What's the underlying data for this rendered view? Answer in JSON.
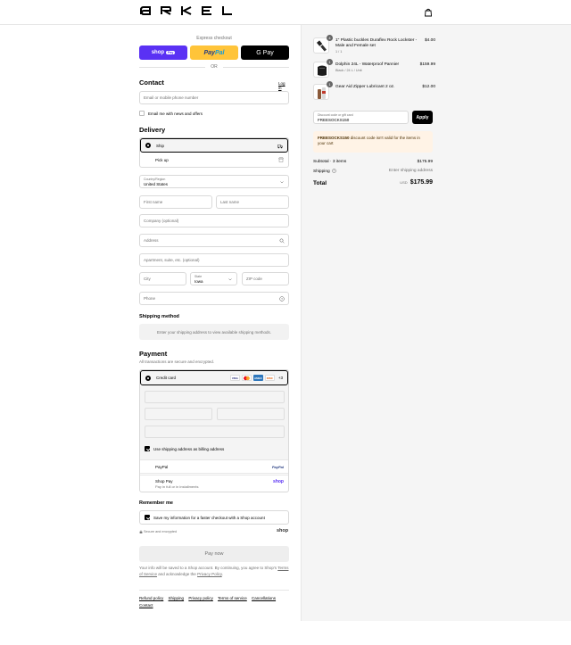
{
  "header": {
    "brand": "ARKEL",
    "cart_icon": "shopping-bag-icon"
  },
  "express": {
    "title": "Express checkout",
    "shop_pay": "shop",
    "shop_pay_pill": "Pay",
    "paypal_a": "Pay",
    "paypal_b": "Pal",
    "gpay": "G Pay",
    "or": "OR"
  },
  "contact": {
    "heading": "Contact",
    "login": "Log in",
    "email_placeholder": "Email or mobile phone number",
    "news_label": "Email me with news and offers",
    "news_checked": false
  },
  "delivery": {
    "heading": "Delivery",
    "options": [
      {
        "label": "Ship",
        "selected": true,
        "icon": "truck-icon"
      },
      {
        "label": "Pick up",
        "selected": false,
        "icon": "store-icon"
      }
    ],
    "country_label": "Country/Region",
    "country_value": "United States",
    "first_name": "First name",
    "last_name": "Last name",
    "company": "Company (optional)",
    "address": "Address",
    "apartment": "Apartment, suite, etc. (optional)",
    "city": "City",
    "state_label": "State",
    "state_value": "Iowa",
    "zip": "ZIP code",
    "phone": "Phone"
  },
  "shipping_method": {
    "heading": "Shipping method",
    "note": "Enter your shipping address to view available shipping methods."
  },
  "payment": {
    "heading": "Payment",
    "subtitle": "All transactions are secure and encrypted.",
    "options": [
      {
        "label": "Credit card",
        "selected": true
      },
      {
        "label": "PayPal",
        "selected": false,
        "logo": "PayPal"
      },
      {
        "label": "Shop Pay",
        "sub": "Pay in full or in installments",
        "selected": false,
        "logo": "shop"
      }
    ],
    "card_brands": [
      "VISA",
      "MC",
      "AMEX",
      "DISC"
    ],
    "more_cards": "+3",
    "billing_label": "Use shipping address as billing address",
    "billing_checked": true
  },
  "remember": {
    "heading": "Remember me",
    "label": "Save my information for a faster checkout with a Shop account",
    "checked": true,
    "secure": "Secure and encrypted",
    "shop_logo": "shop"
  },
  "pay_now": "Pay now",
  "fine_print": {
    "line1": "Your info will be saved to a Shop account. By continuing, you agree to Shop's",
    "tos": "Terms of Service",
    "mid": " and acknowledge the ",
    "privacy": "Privacy Policy",
    "end": "."
  },
  "footer": [
    "Refund policy",
    "Shipping",
    "Privacy policy",
    "Terms of service",
    "Cancellations",
    "Contact"
  ],
  "cart": {
    "items": [
      {
        "name": "1\" Plastic buckles Duraflex Rock Lockster - Male and Female set",
        "variant": "1 / 1",
        "qty": "4",
        "price": "$4.00"
      },
      {
        "name": "Dolphin 24L - Waterproof Pannier",
        "variant": "Black / 24 L / Unit",
        "qty": "1",
        "price": "$159.99"
      },
      {
        "name": "Gear Aid Zipper Lubricant 2 oz.",
        "variant": "",
        "qty": "1",
        "price": "$12.00"
      }
    ],
    "discount_label": "Discount code or gift card",
    "discount_value": "FREESOCKS150",
    "apply": "Apply",
    "warning_code": "FREESOCKS150",
    "warning_text": " discount code isn't valid for the items in your cart",
    "subtotal_label": "Subtotal · 3 items",
    "subtotal_value": "$175.99",
    "shipping_label": "Shipping",
    "shipping_value": "Enter shipping address",
    "total_label": "Total",
    "currency": "USD",
    "total_value": "$175.99"
  }
}
